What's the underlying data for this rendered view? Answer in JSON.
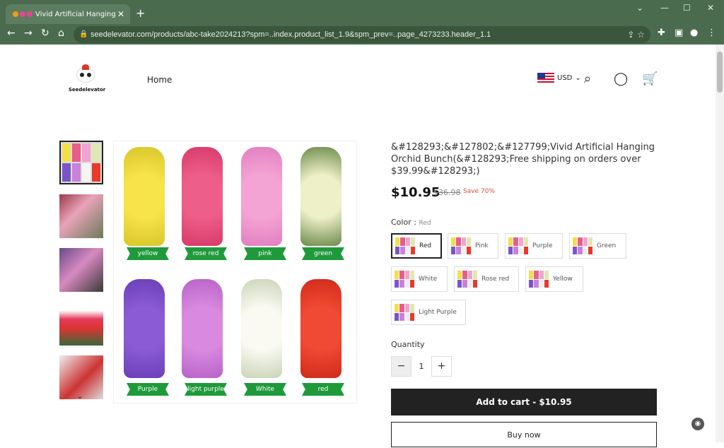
{
  "browser": {
    "tab_title": "Vivid Artificial Hanging",
    "url": "seedelevator.com/products/abc-take2024213?spm=..index.product_list_1.9&spm_prev=..page_4273233.header_1.1"
  },
  "header": {
    "logo_text": "Seedelevator",
    "nav_home": "Home",
    "currency": "USD"
  },
  "product": {
    "title": "&#128293;&#127802;&#127799;Vivid Artificial Hanging Orchid Bunch(&#128293;Free shipping on orders over $39.99&#128293;)",
    "price": "$10.95",
    "old_price": "$36.98",
    "save": "Save 70%",
    "color_label": "Color",
    "color_selected": "Red",
    "colors": [
      "Red",
      "Pink",
      "Purple",
      "Green",
      "White",
      "Rose red",
      "Yellow",
      "Light Purple"
    ],
    "quantity_label": "Quantity",
    "quantity": "1",
    "add_to_cart": "Add to cart  -  $10.95",
    "buy_now": "Buy now"
  },
  "image_labels": [
    "yellow",
    "rose red",
    "pink",
    "green",
    "Purple",
    "light purple",
    "White",
    "red"
  ],
  "icons": {
    "minus": "−",
    "plus": "+"
  }
}
